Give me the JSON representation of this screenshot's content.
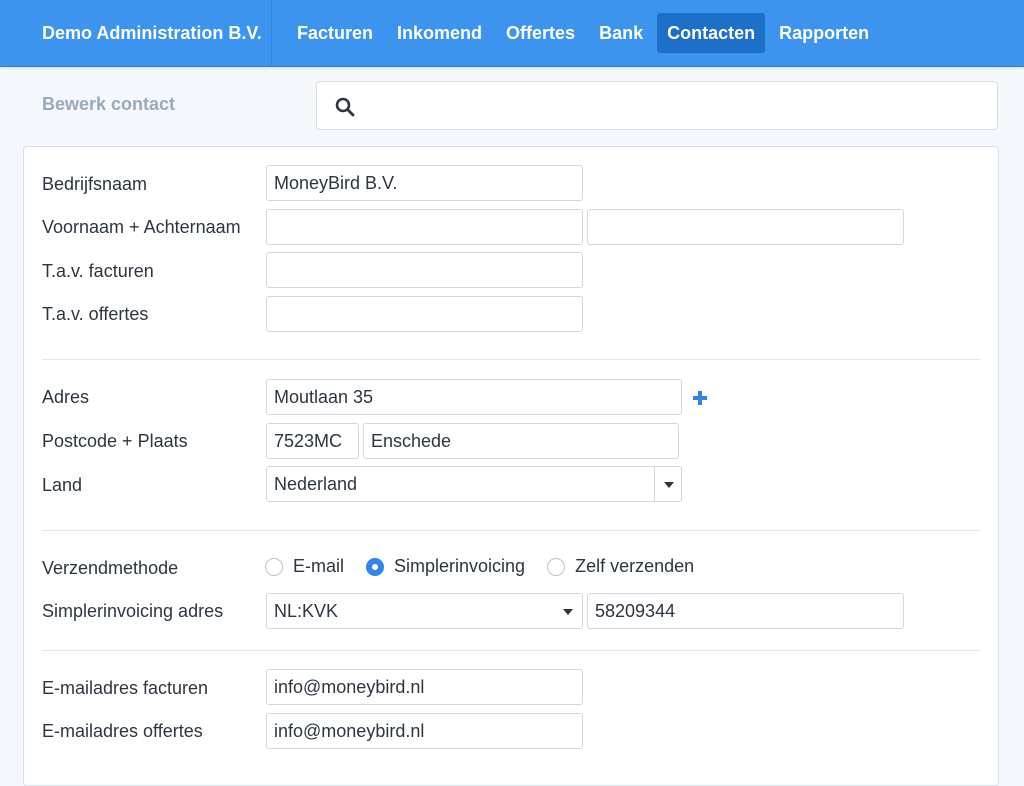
{
  "header": {
    "brand": "Demo Administration B.V.",
    "nav": [
      {
        "label": "Facturen",
        "active": false
      },
      {
        "label": "Inkomend",
        "active": false
      },
      {
        "label": "Offertes",
        "active": false
      },
      {
        "label": "Bank",
        "active": false
      },
      {
        "label": "Contacten",
        "active": true
      },
      {
        "label": "Rapporten",
        "active": false
      }
    ]
  },
  "page": {
    "title": "Bewerk contact",
    "search": {
      "value": "",
      "icon": "search-icon"
    }
  },
  "colors": {
    "accent": "#3d94ee",
    "active_nav": "#1d6fc7",
    "link": "#2f86e6"
  },
  "form": {
    "company": {
      "label": "Bedrijfsnaam",
      "value": "MoneyBird B.V."
    },
    "name": {
      "label": "Voornaam + Achternaam",
      "first": "",
      "last": ""
    },
    "attn_invoices": {
      "label": "T.a.v. facturen",
      "value": ""
    },
    "attn_quotes": {
      "label": "T.a.v. offertes",
      "value": ""
    },
    "address": {
      "label": "Adres",
      "value": "Moutlaan 35",
      "add_icon": "plus-icon"
    },
    "postal": {
      "label": "Postcode + Plaats",
      "zip": "7523MC",
      "city": "Enschede"
    },
    "country": {
      "label": "Land",
      "value": "Nederland"
    },
    "delivery": {
      "label": "Verzendmethode",
      "options": [
        {
          "label": "E-mail",
          "checked": false
        },
        {
          "label": "Simplerinvoicing",
          "checked": true
        },
        {
          "label": "Zelf verzenden",
          "checked": false
        }
      ]
    },
    "si_address": {
      "label": "Simplerinvoicing adres",
      "scheme": "NL:KVK",
      "number": "58209344"
    },
    "email_invoices": {
      "label": "E-mailadres facturen",
      "value": "info@moneybird.nl"
    },
    "email_quotes": {
      "label": "E-mailadres offertes",
      "value": "info@moneybird.nl"
    }
  }
}
